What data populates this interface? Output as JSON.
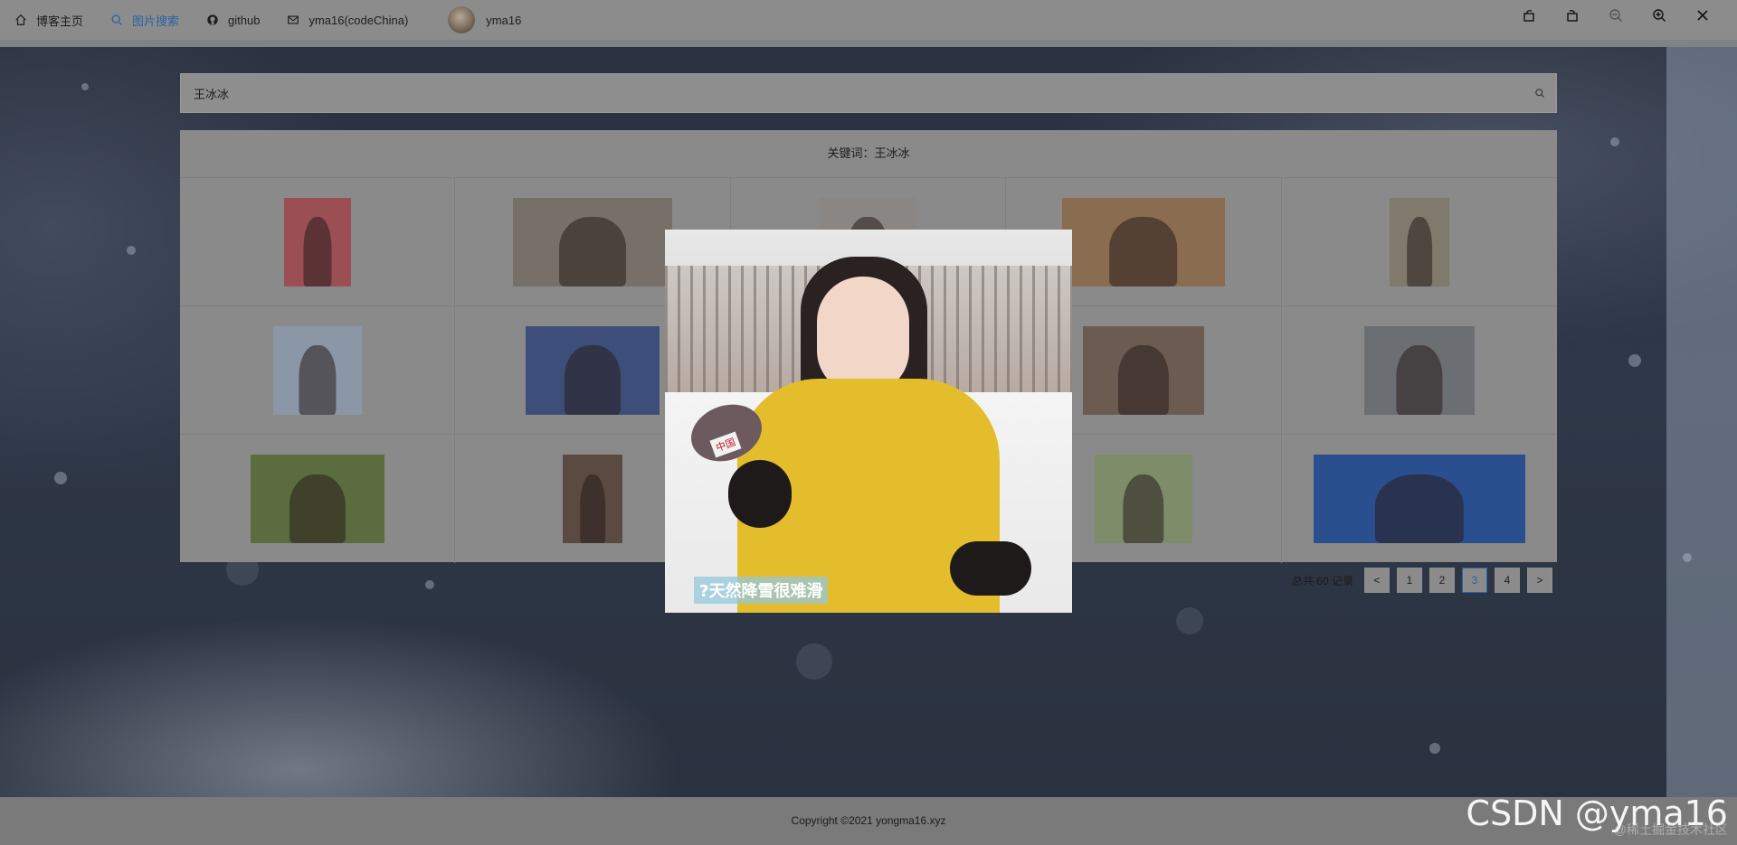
{
  "nav": {
    "items": [
      {
        "label": "博客主页",
        "icon": "home-icon"
      },
      {
        "label": "图片搜索",
        "icon": "search-icon",
        "active": true
      },
      {
        "label": "github",
        "icon": "github-icon"
      },
      {
        "label": "yma16(codeChina)",
        "icon": "mail-icon"
      },
      {
        "label": "yma16",
        "icon": "avatar"
      }
    ]
  },
  "window_controls": [
    "rotate-left-icon",
    "rotate-right-icon",
    "zoom-out-icon",
    "zoom-in-icon",
    "close-icon"
  ],
  "search": {
    "value": "王冰冰",
    "icon": "search-icon"
  },
  "results": {
    "title": "关键词：王冰冰",
    "thumbnails": [
      {
        "color": "#9b4e54"
      },
      {
        "color": "#777069"
      },
      {
        "color": "#8a8684"
      },
      {
        "color": "#8a6d50"
      },
      {
        "color": "#7f7a6c"
      },
      {
        "color": "#8b97a6"
      },
      {
        "color": "#3d4e7a"
      },
      {
        "color": "#7a7574"
      },
      {
        "color": "#6b5b51"
      },
      {
        "color": "#6b6e72"
      },
      {
        "color": "#5b6d3e"
      },
      {
        "color": "#5a4a42"
      },
      {
        "color": "#8a8a8a"
      },
      {
        "color": "#7d8d6a"
      },
      {
        "color": "#2a4f8e"
      }
    ]
  },
  "pagination": {
    "total": "总共 60 记录",
    "prev": "<",
    "next": ">",
    "pages": [
      "1",
      "2",
      "3",
      "4"
    ],
    "current": "3"
  },
  "preview": {
    "caption": "?天然降雪很难滑",
    "mic_label": "中国"
  },
  "footer": {
    "copyright": "Copyright ©2021 yongma16.xyz"
  },
  "watermark": {
    "text": "CSDN @yma16",
    "sub": "@稀土掘金技术社区"
  },
  "colors": {
    "accent": "#2a63a8",
    "nav_bg": "#8c8c8c",
    "jacket": "#e3bd2c"
  }
}
